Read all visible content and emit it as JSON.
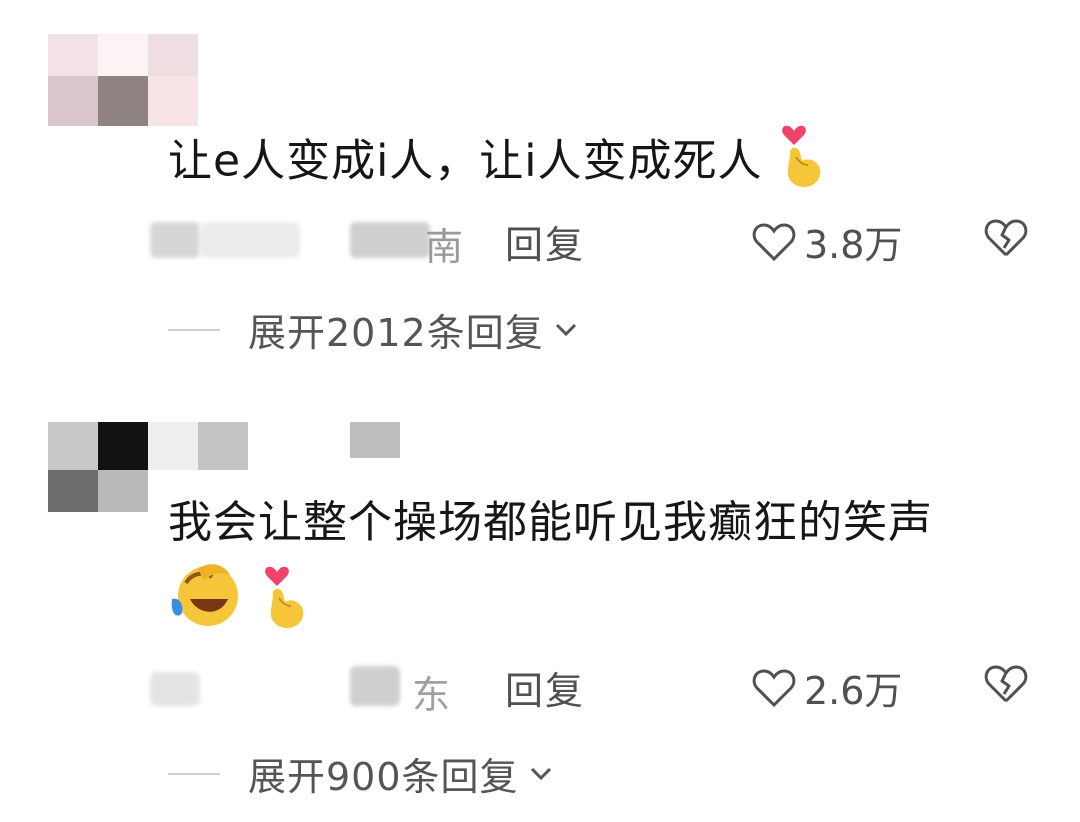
{
  "comments": [
    {
      "text": "让e人变成i人，让i人变成死人",
      "location_fragment": "南",
      "reply_label": "回复",
      "likes": "3.8万",
      "expand_label": "展开2012条回复"
    },
    {
      "text": "我会让整个操场都能听见我癫狂的笑声",
      "location_fragment": "东",
      "reply_label": "回复",
      "likes": "2.6万",
      "expand_label": "展开900条回复"
    }
  ],
  "icons": {
    "like": "heart-outline-icon",
    "dislike": "broken-heart-icon",
    "expand": "chevron-down-icon",
    "emoji_1": "finger-heart-emoji",
    "emoji_2": "rolling-laughing-emoji"
  },
  "colors": {
    "text": "#161616",
    "meta": "#505050",
    "heart_emoji": "#f0426a",
    "hand_emoji": "#f5c53a"
  }
}
